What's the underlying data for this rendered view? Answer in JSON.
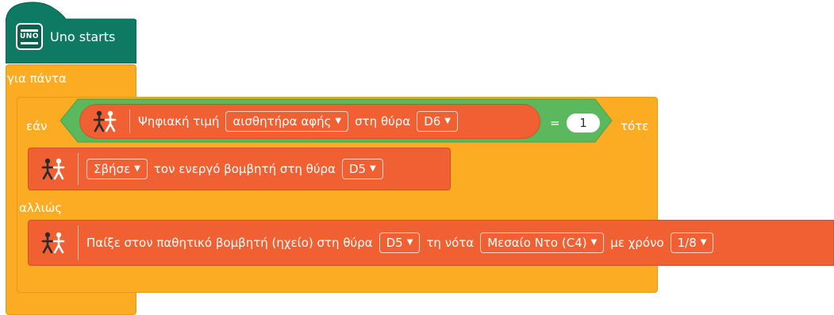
{
  "hat": {
    "icon_label": "UNO",
    "label": "Uno starts"
  },
  "forever": {
    "label": "για πάντα"
  },
  "if_block": {
    "if_label": "εάν",
    "then_label": "τότε",
    "else_label": "αλλιώς"
  },
  "condition": {
    "read_label": "Ψηφιακή τιμή",
    "sensor_value": "αισθητήρα αφής",
    "port_label": "στη θύρα",
    "port_value": "D6",
    "operator": "=",
    "compare_value": "1"
  },
  "then_action": {
    "mode_value": "Σβήσε",
    "text": "τον ενεργό βομβητή στη θύρα",
    "port_value": "D5"
  },
  "else_action": {
    "text": "Παίξε στον παθητικό βομβητή (ηχείο) στη θύρα",
    "port_value": "D5",
    "note_label": "τη νότα",
    "note_value": "Μεσαίο Ντο (C4)",
    "time_label": "με χρόνο",
    "time_value": "1/8"
  },
  "colors": {
    "hat": "#0f7a64",
    "control": "#fbac22",
    "operator": "#5cb85c",
    "action": "#f06033"
  },
  "icons": [
    "uno-board-icon",
    "people-icon",
    "caret-down-icon"
  ]
}
